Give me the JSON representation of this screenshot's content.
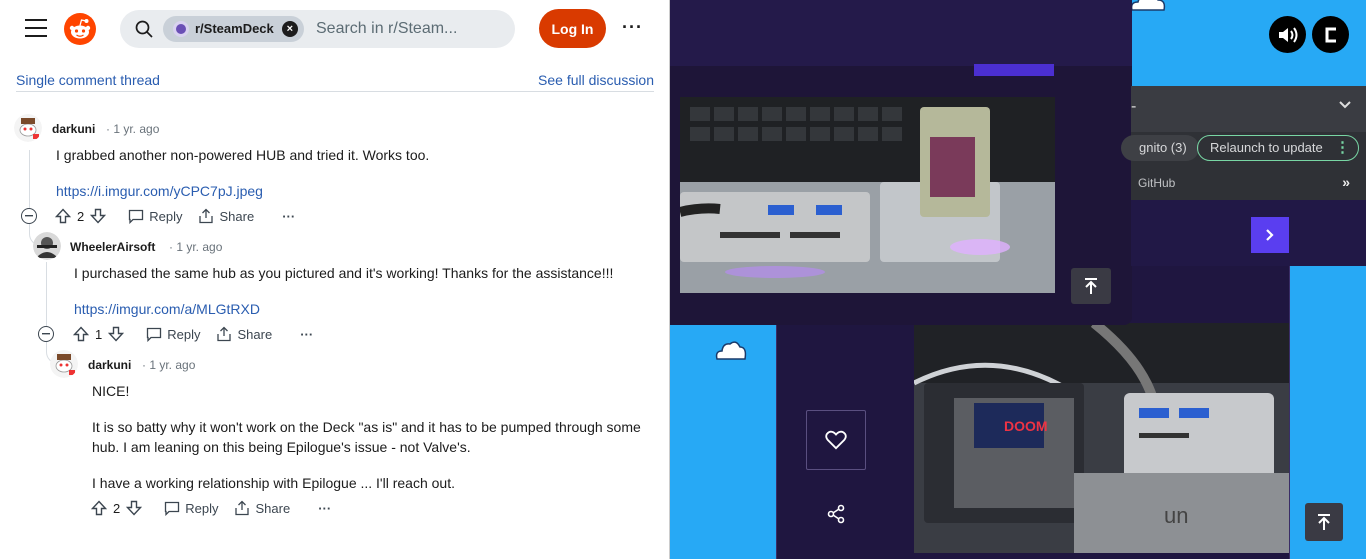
{
  "browser": {
    "incognito_label": "gnito (3)",
    "relaunch_label": "Relaunch to update",
    "github_label": "GitHub",
    "more_label": "»"
  },
  "header": {
    "subreddit": "r/SteamDeck",
    "search_placeholder": "Search in r/Steam...",
    "login_label": "Log In",
    "more_label": "···"
  },
  "thread": {
    "single_label": "Single comment thread",
    "full_label": "See full discussion"
  },
  "comments": [
    {
      "author": "darkuni",
      "time": "· 1 yr. ago",
      "body": [
        "I grabbed another non-powered HUB and tried it. Works too."
      ],
      "link": "https://i.imgur.com/yCPC7pJ.jpeg",
      "votes": "2",
      "reply_label": "Reply",
      "share_label": "Share",
      "more_label": "···"
    },
    {
      "author": "WheelerAirsoft",
      "time": "· 1 yr. ago",
      "body": [
        "I purchased the same hub as you pictured and it's working! Thanks for the assistance!!!"
      ],
      "link": "https://imgur.com/a/MLGtRXD",
      "votes": "1",
      "reply_label": "Reply",
      "share_label": "Share",
      "more_label": "···"
    },
    {
      "author": "darkuni",
      "time": "· 1 yr. ago",
      "body": [
        "NICE!",
        "It is so batty why it won't work on the Deck \"as is\" and it has to be pumped through some hub. I am leaning on this being Epilogue's issue - not Valve's.",
        "I have a working relationship with Epilogue ... I'll reach out."
      ],
      "votes": "2",
      "reply_label": "Reply",
      "share_label": "Share",
      "more_label": "···"
    }
  ],
  "colors": {
    "accent_link": "#2a5db0",
    "login_bg": "#d93a00",
    "reddit_orange": "#ff4500",
    "site_bg": "#27a9f5",
    "panel_dark": "#1e1538",
    "relaunch_border": "#78d6a4",
    "next_button": "#5a3ef0"
  }
}
